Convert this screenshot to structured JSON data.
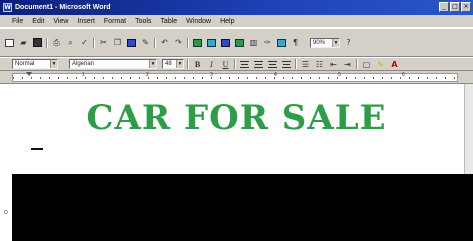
{
  "window": {
    "title": "Document1 - Microsoft Word",
    "controls": [
      "_",
      "□",
      "×"
    ]
  },
  "menu": {
    "items": [
      "File",
      "Edit",
      "View",
      "Insert",
      "Format",
      "Tools",
      "Table",
      "Window",
      "Help"
    ]
  },
  "standard_toolbar": {
    "zoom": "90%"
  },
  "formatting_toolbar": {
    "style": "Normal",
    "font": "Algerian",
    "size": "48",
    "bold": "B",
    "italic": "I",
    "underline": "U"
  },
  "ruler": {
    "numbers": [
      "1",
      "2",
      "3",
      "4",
      "5",
      "6"
    ]
  },
  "document": {
    "heading": "CAR FOR SALE",
    "heading_color": "#2d9e47"
  },
  "left_fragment": "o"
}
